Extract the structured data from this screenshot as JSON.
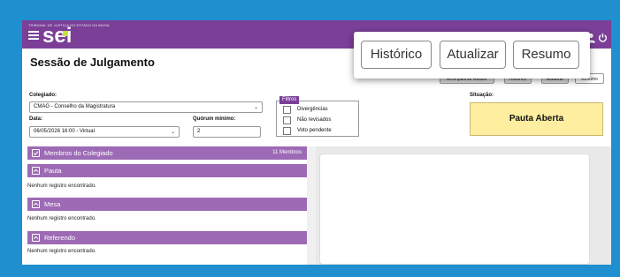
{
  "header": {
    "tribunal": "TRIBUNAL DE JUSTIÇA DO ESTADO DA BAHIA",
    "logo": "sei",
    "accent": "#7b3f98"
  },
  "page": {
    "title": "Sessão de Julgamento"
  },
  "toolbar": {
    "buttons": [
      "Acompanhar Relator",
      "Histórico",
      "Atualizar",
      "Resumo"
    ]
  },
  "zoom_callout": {
    "buttons": [
      "Histórico",
      "Atualizar",
      "Resumo"
    ]
  },
  "form": {
    "colegiado_label": "Colegiado:",
    "colegiado_value": "CMAG - Conselho da Magistratura",
    "data_label": "Data:",
    "data_value": "06/05/2026 16:00 - Virtual",
    "quorum_label": "Quórum mínimo:",
    "quorum_value": "2"
  },
  "filtros": {
    "legend": "Filtros",
    "items": [
      "Divergências",
      "Não revisados",
      "Voto pendente"
    ]
  },
  "situacao": {
    "label": "Situação:",
    "value": "Pauta Aberta",
    "color": "#fdeea0"
  },
  "sections": [
    {
      "label": "Membros do Colegiado",
      "count": "11 Membros"
    },
    {
      "label": "Pauta",
      "empty": "Nenhum registro encontrado."
    },
    {
      "label": "Mesa",
      "empty": "Nenhum registro encontrado."
    },
    {
      "label": "Referendo",
      "empty": "Nenhum registro encontrado."
    }
  ]
}
